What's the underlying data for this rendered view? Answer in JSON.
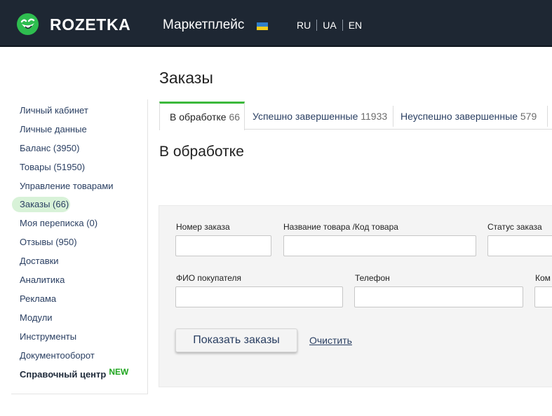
{
  "header": {
    "brand": "ROZETKA",
    "marketplace": "Маркетплейс",
    "languages": [
      "RU",
      "UA",
      "EN"
    ]
  },
  "sidebar": {
    "items": [
      {
        "label": "Личный кабинет"
      },
      {
        "label": "Личные данные"
      },
      {
        "label": "Баланс (3950)"
      },
      {
        "label": "Товары (51950)"
      },
      {
        "label": "Управление товарами"
      },
      {
        "label": "Заказы (66)"
      },
      {
        "label": "Моя переписка (0)"
      },
      {
        "label": "Отзывы (950)"
      },
      {
        "label": "Доставки"
      },
      {
        "label": "Аналитика"
      },
      {
        "label": "Реклама"
      },
      {
        "label": "Модули"
      },
      {
        "label": "Инструменты"
      },
      {
        "label": "Документооборот"
      },
      {
        "label": "Справочный центр",
        "badge": "NEW"
      }
    ],
    "active_item": "Заказы (66)"
  },
  "page": {
    "title": "Заказы",
    "section_title": "В обработке"
  },
  "tabs": [
    {
      "label": "В обработке",
      "count": "66"
    },
    {
      "label": "Успешно завершенные",
      "count": "11933"
    },
    {
      "label": "Неуспешно завершенные",
      "count": "579"
    }
  ],
  "filters": {
    "order_number_label": "Номер заказа",
    "product_label": "Название товара /Код товара",
    "status_label": "Статус заказа",
    "buyer_label": "ФИО покупателя",
    "phone_label": "Телефон",
    "comment_label": "Ком",
    "order_number_value": "",
    "product_value": "",
    "status_value": "",
    "buyer_value": "",
    "phone_value": "",
    "comment_value": ""
  },
  "actions": {
    "show_orders": "Показать заказы",
    "clear": "Очистить"
  },
  "colors": {
    "header_bg": "#1e2733",
    "logo_green": "#2ebd4f",
    "active_tab_accent": "#3cb93c",
    "new_badge": "#1ea51e",
    "link": "#2a3f62"
  },
  "icons": {
    "logo": "rozetka-smile-logo-icon",
    "flag": "ukraine-flag-icon"
  }
}
